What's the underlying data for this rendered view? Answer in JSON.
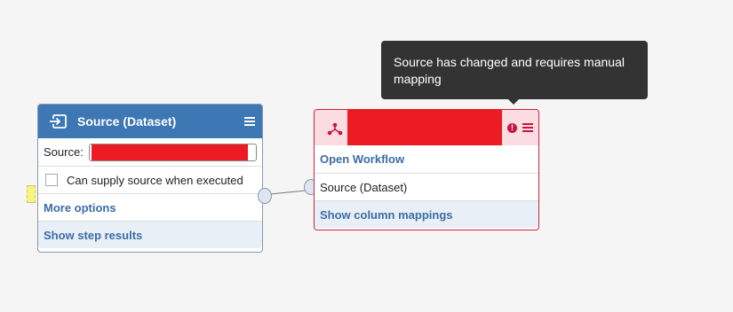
{
  "source_node": {
    "title": "Source (Dataset)",
    "source_label": "Source:",
    "supply_checkbox_label": "Can supply source when executed",
    "supply_checked": false,
    "more_options": "More options",
    "show_results": "Show step results"
  },
  "workflow_node": {
    "open_link": "Open Workflow",
    "input_label": "Source (Dataset)",
    "mappings_link": "Show column mappings"
  },
  "tooltip": {
    "text": "Source has changed and requires manual mapping"
  },
  "colors": {
    "source_header": "#3d77b4",
    "workflow_accent": "#c8163a",
    "workflow_header_bg": "#fbdce2",
    "link": "#3a6da5",
    "redaction": "#ec1c24"
  },
  "icons": {
    "source_icon": "input-arrow-icon",
    "workflow_icon": "workflow-tree-icon",
    "warning_icon": "exclamation-circle-icon",
    "menu_icon": "hamburger-menu-icon"
  }
}
